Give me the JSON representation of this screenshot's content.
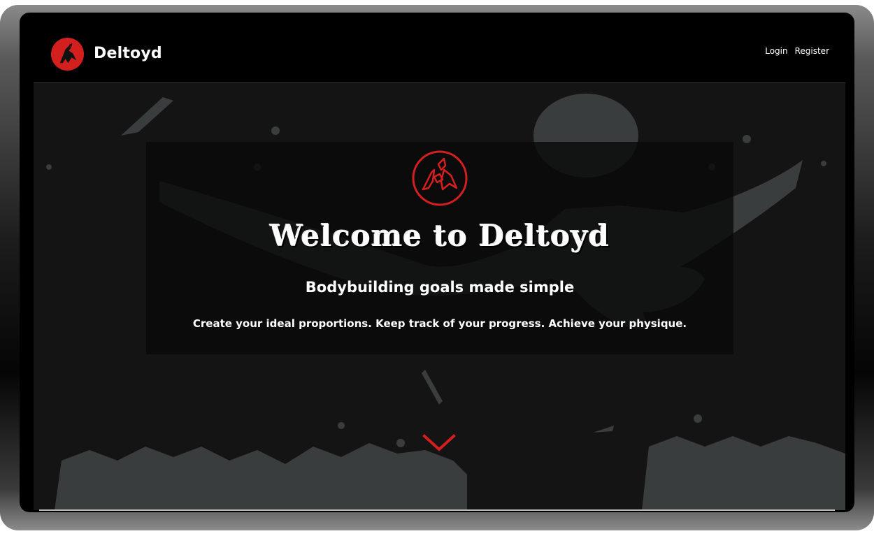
{
  "header": {
    "brand": "Deltoyd",
    "nav": {
      "login": "Login",
      "register": "Register"
    }
  },
  "hero": {
    "title": "Welcome to Deltoyd",
    "tagline": "Bodybuilding goals made simple",
    "subline": "Create your ideal proportions. Keep track of your progress. Achieve your physique."
  },
  "colors": {
    "brand_red": "#d41f1f",
    "background": "#141414",
    "text": "#ffffff"
  },
  "icons": {
    "logo": "deltoyd-logo-icon",
    "scroll": "chevron-down-icon"
  }
}
